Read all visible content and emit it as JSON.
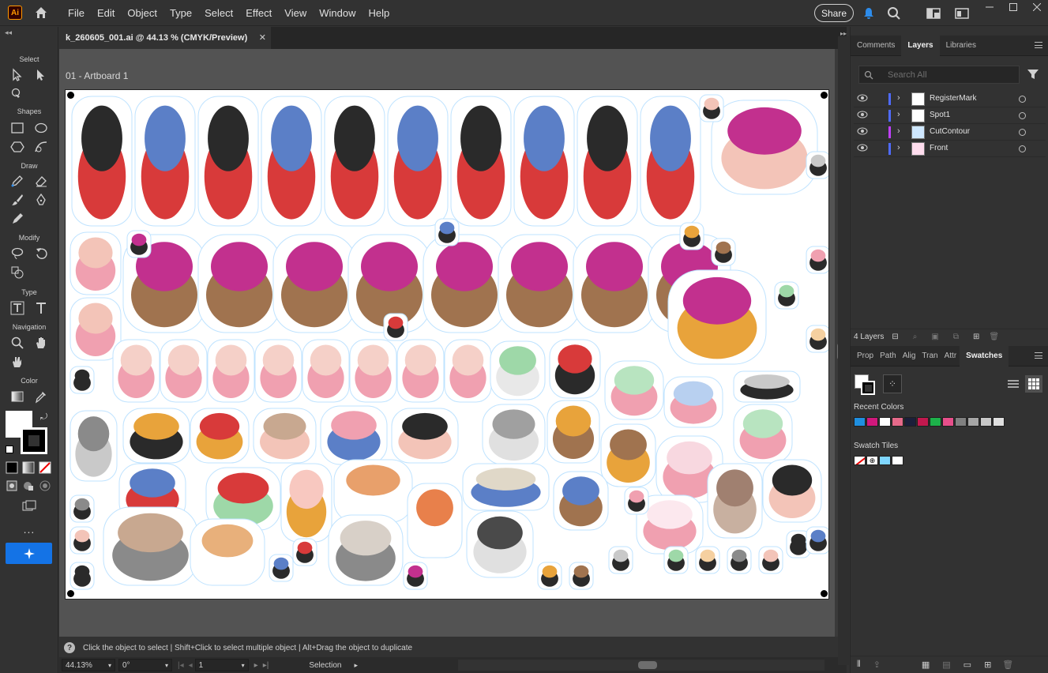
{
  "app": {
    "logo_text": "Ai",
    "menu": [
      "File",
      "Edit",
      "Object",
      "Type",
      "Select",
      "Effect",
      "View",
      "Window",
      "Help"
    ],
    "share_label": "Share"
  },
  "toolbar": {
    "sections": {
      "select": "Select",
      "shapes": "Shapes",
      "draw": "Draw",
      "modify": "Modify",
      "type": "Type",
      "navigation": "Navigation",
      "color": "Color"
    },
    "more": "..."
  },
  "document": {
    "tab_title": "k_260605_001.ai @ 44.13 % (CMYK/Preview)",
    "artboard_label": "01 - Artboard 1"
  },
  "hint": {
    "icon": "?",
    "text": "Click the object to select  |  Shift+Click to select multiple object  |  Alt+Drag the object to duplicate"
  },
  "status": {
    "zoom": "44.13%",
    "rotation": "0°",
    "artboard_number": "1",
    "tool": "Selection"
  },
  "layers_panel": {
    "tabs": [
      "Comments",
      "Layers",
      "Libraries"
    ],
    "active_tab": "Layers",
    "search_placeholder": "Search All",
    "layers": [
      {
        "name": "RegisterMark",
        "color": "#4f6bff"
      },
      {
        "name": "Spot1",
        "color": "#4f6bff"
      },
      {
        "name": "CutContour",
        "color": "#c040ff"
      },
      {
        "name": "Front",
        "color": "#4f6bff"
      }
    ],
    "count_label": "4 Layers"
  },
  "swatches_panel": {
    "tabs": [
      "Prop",
      "Path",
      "Alig",
      "Tran",
      "Attr",
      "Swatches"
    ],
    "active_tab": "Swatches",
    "recent_colors_label": "Recent Colors",
    "recent_colors": [
      "#1f8fe0",
      "#d0187c",
      "#ffffff",
      "#e66a8a",
      "#1b1f3a",
      "#c2184e",
      "#1db14a",
      "#e74f8b",
      "#808080",
      "#a6a6a6",
      "#c8c8c8",
      "#e0e0e0"
    ],
    "swatch_tiles_label": "Swatch Tiles"
  }
}
